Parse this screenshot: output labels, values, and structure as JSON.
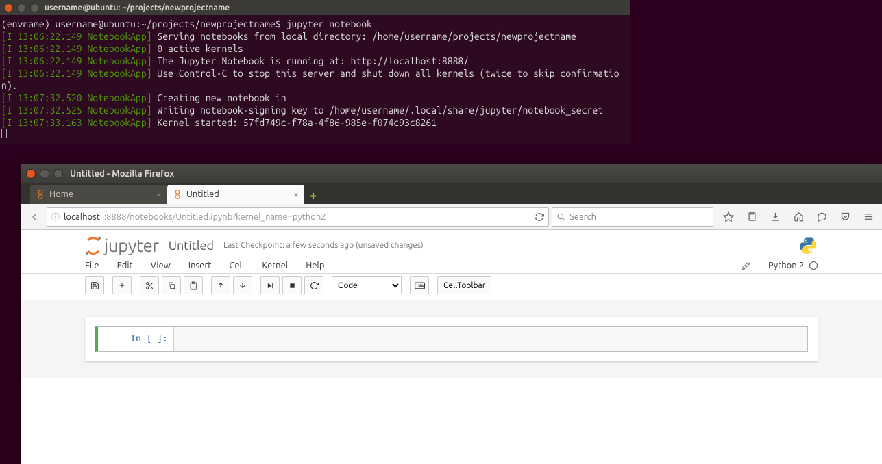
{
  "terminal": {
    "title": "username@ubuntu: ~/projects/newprojectname",
    "prompt_env": "(envname) ",
    "prompt_userhost": "username@ubuntu",
    "prompt_path": ":~/projects/newprojectname$",
    "command": " jupyter notebook",
    "lines": [
      {
        "prefix": "[I 13:06:22.149 NotebookApp]",
        "text": " Serving notebooks from local directory: /home/username/projects/newprojectname"
      },
      {
        "prefix": "[I 13:06:22.149 NotebookApp]",
        "text": " 0 active kernels"
      },
      {
        "prefix": "[I 13:06:22.149 NotebookApp]",
        "text": " The Jupyter Notebook is running at: http://localhost:8888/"
      },
      {
        "prefix": "[I 13:06:22.149 NotebookApp]",
        "text": " Use Control-C to stop this server and shut down all kernels (twice to skip confirmation)."
      },
      {
        "prefix": "[I 13:07:32.520 NotebookApp]",
        "text": " Creating new notebook in"
      },
      {
        "prefix": "[I 13:07:32.525 NotebookApp]",
        "text": " Writing notebook-signing key to /home/username/.local/share/jupyter/notebook_secret"
      },
      {
        "prefix": "[I 13:07:33.163 NotebookApp]",
        "text": " Kernel started: 57fd749c-f78a-4f86-985e-f074c93c8261"
      }
    ]
  },
  "firefox": {
    "title": "Untitled - Mozilla Firefox",
    "tabs": [
      {
        "label": "Home",
        "active": false
      },
      {
        "label": "Untitled",
        "active": true
      }
    ],
    "url_host": "localhost",
    "url_rest": ":8888/notebooks/Untitled.ipynb?kernel_name=python2",
    "search_placeholder": "Search"
  },
  "jupyter": {
    "logo_text": "jupyter",
    "doc_title": "Untitled",
    "checkpoint": "Last Checkpoint: a few seconds ago (unsaved changes)",
    "menu": [
      "File",
      "Edit",
      "View",
      "Insert",
      "Cell",
      "Kernel",
      "Help"
    ],
    "kernel_name": "Python 2",
    "cell_type_selected": "Code",
    "cell_toolbar_label": "CellToolbar",
    "cell_prompt": "In [ ]:"
  }
}
